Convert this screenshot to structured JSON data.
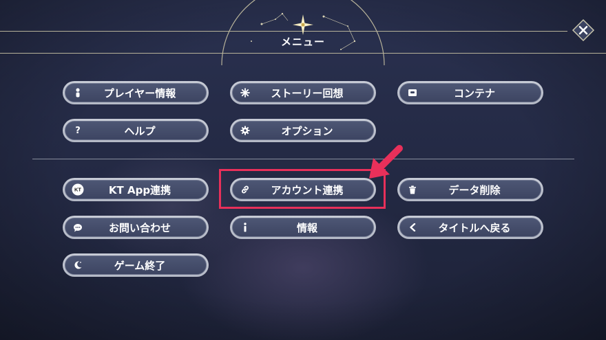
{
  "header": {
    "title": "メニュー"
  },
  "close_button": {
    "icon": "close-icon"
  },
  "menu_top": [
    {
      "label": "プレイヤー情報",
      "icon": "player-icon"
    },
    {
      "label": "ストーリー回想",
      "icon": "sparkle-icon"
    },
    {
      "label": "コンテナ",
      "icon": "container-icon"
    },
    {
      "label": "ヘルプ",
      "icon": "help-icon"
    },
    {
      "label": "オプション",
      "icon": "gear-icon"
    }
  ],
  "menu_bottom": [
    {
      "label": "KT App連携",
      "icon": "kt-logo-icon"
    },
    {
      "label": "アカウント連携",
      "icon": "link-icon"
    },
    {
      "label": "データ削除",
      "icon": "trash-icon"
    },
    {
      "label": "お問い合わせ",
      "icon": "chat-icon"
    },
    {
      "label": "情報",
      "icon": "info-icon"
    },
    {
      "label": "タイトルへ戻る",
      "icon": "back-icon"
    },
    {
      "label": "ゲーム終了",
      "icon": "moon-icon"
    }
  ],
  "kt_logo_text": "KT",
  "colors": {
    "highlight": "#e8305a",
    "button_bg": "#414a68",
    "button_border": "#c0c4cf"
  }
}
